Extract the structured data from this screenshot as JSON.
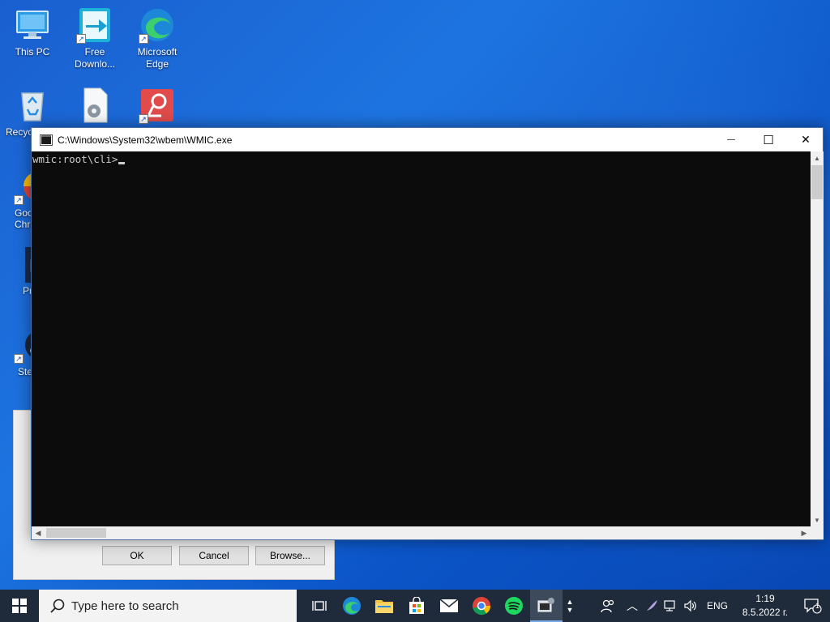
{
  "desktop": {
    "icons": [
      {
        "label": "This PC"
      },
      {
        "label": "Free Downlo..."
      },
      {
        "label": "Microsoft Edge"
      },
      {
        "label": "Recyc"
      },
      {
        "label": "Goo Chro"
      },
      {
        "label": "Pr"
      },
      {
        "label": "Ste"
      }
    ]
  },
  "dialog": {
    "ok_label": "OK",
    "cancel_label": "Cancel",
    "browse_label": "Browse..."
  },
  "console": {
    "title": "C:\\Windows\\System32\\wbem\\WMIC.exe",
    "prompt": "wmic:root\\cli>",
    "minimize_glyph": "—",
    "maximize_glyph": "☐",
    "close_glyph": "✕"
  },
  "taskbar": {
    "search_placeholder": "Type here to search",
    "language": "ENG",
    "time": "1:19",
    "date": "8.5.2022 г.",
    "notification_count": "1"
  },
  "colors": {
    "console_bg": "#0c0c0c",
    "console_text": "#cccccc",
    "taskbar_bg": "#1f2a3a"
  }
}
